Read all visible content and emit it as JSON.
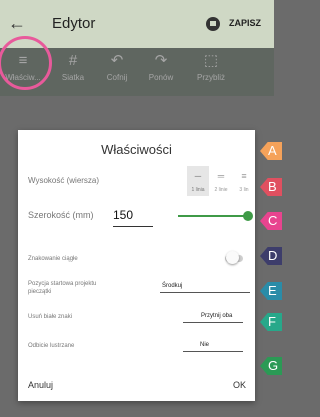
{
  "appbar": {
    "back_icon": "arrow-left-icon",
    "title": "Edytor",
    "save_icon": "disk-icon",
    "save_label": "ZAPISZ"
  },
  "toolbar": {
    "items": [
      {
        "icon": "sliders-icon",
        "label": "Właściw..."
      },
      {
        "icon": "grid-icon",
        "label": "Siatka"
      },
      {
        "icon": "undo-icon",
        "label": "Cofnij"
      },
      {
        "icon": "redo-icon",
        "label": "Ponów"
      },
      {
        "icon": "zoom-frame-icon",
        "label": "Przybliż"
      }
    ]
  },
  "dialog": {
    "title": "Właściwości",
    "height_label": "Wysokość (wiersza)",
    "height_options": [
      "1 linia",
      "2 linie",
      "3 lin"
    ],
    "height_selected": "1 linia",
    "width_label": "Szerokość (mm)",
    "width_value": "150",
    "continuous_label": "Znakowanie ciągłe",
    "continuous_on": false,
    "start_pos_label": "Pozycja startowa projektu pieczątki",
    "start_pos_value": "Środkuj",
    "remove_white_label": "Usuń białe znaki",
    "remove_white_value": "Przytnij oba",
    "mirror_label": "Odbicie lustrzane",
    "mirror_value": "Nie",
    "cancel_label": "Anuluj",
    "ok_label": "OK"
  },
  "markers": [
    {
      "letter": "A",
      "color": "#f5a25a"
    },
    {
      "letter": "B",
      "color": "#e05060"
    },
    {
      "letter": "C",
      "color": "#e8448f"
    },
    {
      "letter": "D",
      "color": "#3d3d6b"
    },
    {
      "letter": "E",
      "color": "#2a8ca8"
    },
    {
      "letter": "F",
      "color": "#27a88a"
    },
    {
      "letter": "G",
      "color": "#2b9a55"
    }
  ],
  "colors": {
    "accent": "#3f9a47",
    "highlight_ring": "#e85a9b"
  }
}
